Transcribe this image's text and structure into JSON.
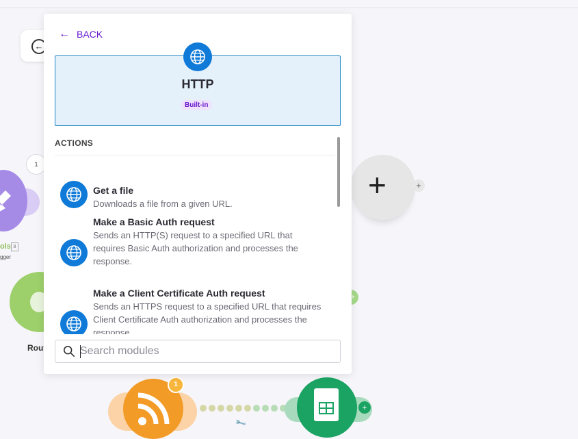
{
  "panel": {
    "back_label": "BACK",
    "app": {
      "name": "HTTP",
      "badge": "Built-in",
      "icon": "globe-icon"
    },
    "section_title": "ACTIONS",
    "actions": [
      {
        "title": "Get a file",
        "description": "Downloads a file from a given URL.",
        "icon": "globe-icon"
      },
      {
        "title": "Make a Basic Auth request",
        "description": "Sends an HTTP(S) request to a specified URL that requires Basic Auth authorization and processes the response.",
        "icon": "globe-icon"
      },
      {
        "title": "Make a Client Certificate Auth request",
        "description": "Sends an HTTPS request to a specified URL that requires Client Certificate Auth authorization and processes the response.",
        "icon": "globe-icon"
      }
    ],
    "search": {
      "placeholder": "Search modules",
      "value": ""
    }
  },
  "canvas": {
    "tools_module": {
      "label": "ols",
      "sub_label": "gger",
      "bubble_count": "1"
    },
    "router_label": "Rout",
    "rss_badge": "1"
  },
  "colors": {
    "accent": "#6a1bcf",
    "http_blue": "#0f7ad8",
    "card_bg": "#e4f1fb",
    "card_border": "#1e83c6"
  }
}
